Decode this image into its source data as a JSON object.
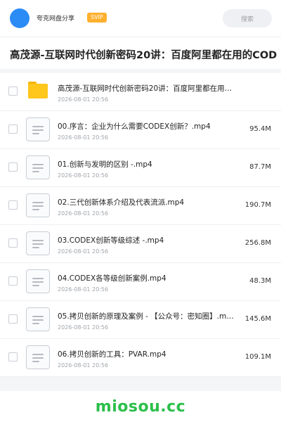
{
  "header": {
    "owner_name": "夸克网盘分享",
    "vip_badge": "SVIP",
    "search_placeholder": "搜索"
  },
  "title": "高茂源-互联网时代创新密码20讲：百度阿里都在用的COD",
  "files": [
    {
      "type": "folder",
      "name": "高茂源-互联网时代创新密码20讲：百度阿里都在用的COD",
      "date": "2026-08-01 20:56",
      "size": ""
    },
    {
      "type": "file",
      "name": "00.序言：企业为什么需要CODEX创新？.mp4",
      "date": "2026-08-01 20:56",
      "size": "95.4M"
    },
    {
      "type": "file",
      "name": "01.创新与发明的区别 -.mp4",
      "date": "2026-08-01 20:56",
      "size": "87.7M"
    },
    {
      "type": "file",
      "name": "02.三代创新体系介绍及代表流派.mp4",
      "date": "2026-08-01 20:56",
      "size": "190.7M"
    },
    {
      "type": "file",
      "name": "03.CODEX创新等级综述 -.mp4",
      "date": "2026-08-01 20:56",
      "size": "256.8M"
    },
    {
      "type": "file",
      "name": "04.CODEX各等级创新案例.mp4",
      "date": "2026-08-01 20:56",
      "size": "48.3M"
    },
    {
      "type": "file",
      "name": "05.拷贝创新的原理及案例 - 【公众号：密知圈】.mp4",
      "date": "2026-08-01 20:56",
      "size": "145.6M"
    },
    {
      "type": "file",
      "name": "06.拷贝创新的工具：PVAR.mp4",
      "date": "2026-08-01 20:56",
      "size": "109.1M"
    }
  ],
  "watermark": "miosou.cc",
  "colors": {
    "accent": "#2b8cf6",
    "vip": "#ffb02e",
    "folder": "#ffc61b",
    "watermark": "#2bbf4a"
  }
}
